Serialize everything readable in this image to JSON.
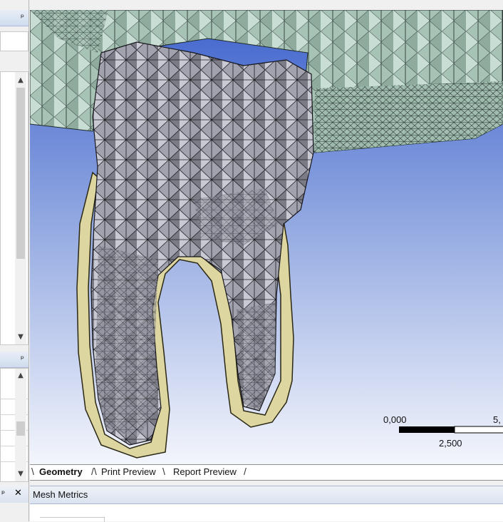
{
  "tabs": [
    {
      "label": "Geometry",
      "active": true
    },
    {
      "label": "Print Preview",
      "active": false
    },
    {
      "label": "Report Preview",
      "active": false
    }
  ],
  "scale_bar": {
    "left_label": "0,000",
    "right_label": "5,",
    "mid_label": "2,500"
  },
  "bottom_panel": {
    "title": "Mesh Metrics"
  },
  "colors": {
    "background_top": "#4d6fd1",
    "background_bottom": "#f2f4fb",
    "jaw_mesh": "#a9c4b8",
    "tooth_mesh": "#a3a3ad",
    "ligament": "#ddd6a0",
    "tab_bar": "#ffffff"
  },
  "icons": {
    "pin": "pin-icon",
    "close": "close-icon",
    "scroll_up": "chevron-up-icon",
    "scroll_down": "chevron-down-icon"
  }
}
